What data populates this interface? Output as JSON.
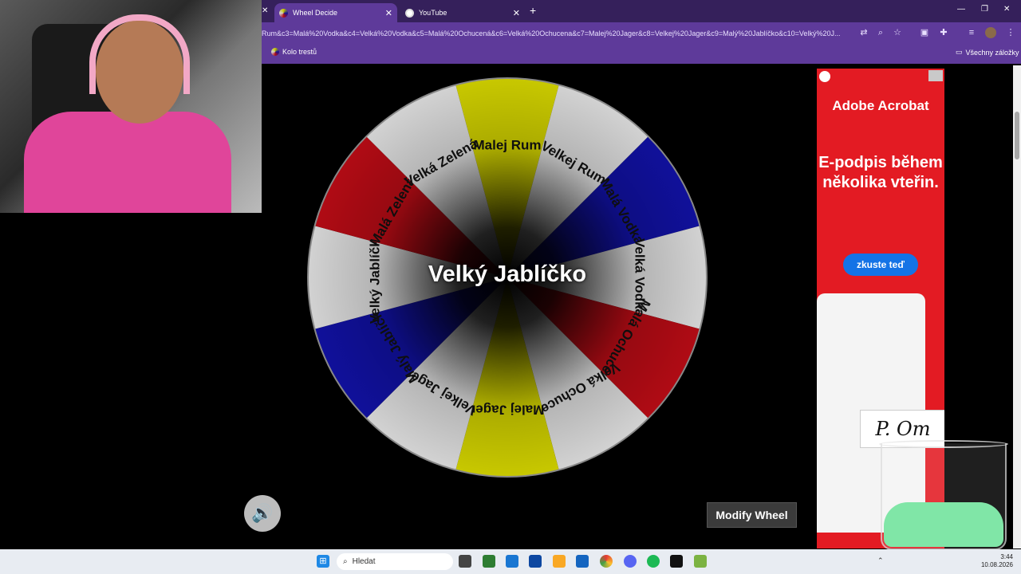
{
  "browser": {
    "tabs": [
      {
        "label": "Wheel Decide",
        "active": true
      },
      {
        "label": "YouTube",
        "active": false
      }
    ],
    "new_tab": "+",
    "url": "Rum&c3=Malá%20Vodka&c4=Velká%20Vodka&c5=Malá%20Ochucená&c6=Velká%20Ochucena&c7=Malej%20Jager&c8=Velkej%20Jager&c9=Malý%20Jablíčko&c10=Velký%20J...",
    "bookmarks": [
      {
        "label": "Kolo trestů"
      }
    ],
    "all_bookmarks": "Všechny záložky",
    "window_controls": {
      "minimize": "—",
      "maximize": "❐",
      "close": "✕"
    }
  },
  "wheel": {
    "result": "Velký Jablíčko",
    "segments": [
      {
        "label": "Malej Rum",
        "color": "#c8c800"
      },
      {
        "label": "Velkej Rum",
        "color": "#d2d2d2"
      },
      {
        "label": "Malá Vodka",
        "color": "#10109a"
      },
      {
        "label": "Velká Vodka",
        "color": "#d2d2d2"
      },
      {
        "label": "Malá Ochucená",
        "color": "#b00b14"
      },
      {
        "label": "Velká Ochucena",
        "color": "#d2d2d2"
      },
      {
        "label": "Malej Jager",
        "color": "#c8c800"
      },
      {
        "label": "Velkej Jager",
        "color": "#d2d2d2"
      },
      {
        "label": "Malý Jablíčko",
        "color": "#10109a"
      },
      {
        "label": "Velký Jablíčko",
        "color": "#d2d2d2"
      },
      {
        "label": "Malá Zelená",
        "color": "#b00b14"
      },
      {
        "label": "Velká Zelená",
        "color": "#d2d2d2"
      }
    ],
    "modify_label": "Modify Wheel",
    "speaker_icon": "🔊"
  },
  "ad": {
    "brand": "Adobe Acrobat",
    "headline": "E-podpis během několika vteřin.",
    "cta": "zkuste teď",
    "signature": "P. Om"
  },
  "taskbar": {
    "search_placeholder": "Hledat",
    "time": "3:44",
    "date": "10.08.2026"
  }
}
